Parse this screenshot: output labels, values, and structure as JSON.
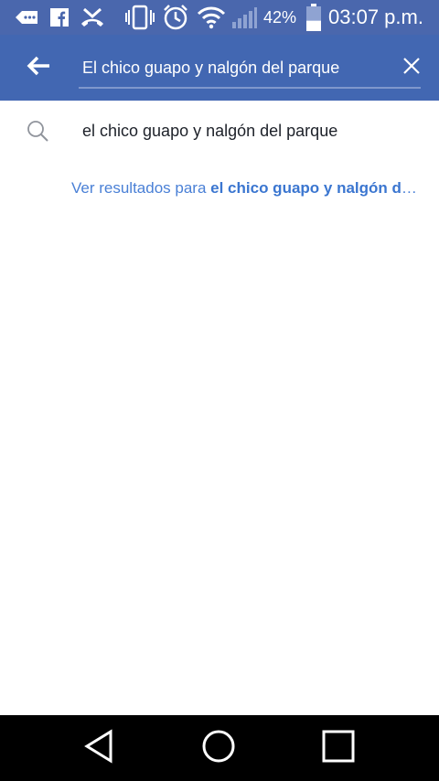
{
  "status_bar": {
    "icons": [
      "messenger-icon",
      "facebook-icon",
      "missed-call-icon",
      "vibrate-icon",
      "alarm-icon",
      "wifi-icon",
      "signal-icon"
    ],
    "battery_percent_label": "42%",
    "battery_level": 0.42,
    "time": "03:07 p.m."
  },
  "app_bar": {
    "back_icon": "arrow-left-icon",
    "search_value": "El chico guapo y nalgón del parque",
    "clear_icon": "close-icon"
  },
  "suggestion": {
    "icon": "search-icon",
    "text": "el chico guapo y nalgón del parque"
  },
  "see_results": {
    "prefix": "Ver resultados para ",
    "query": "el chico guapo y nalgón del parque"
  },
  "nav_bar": {
    "icons": [
      "back-triangle-icon",
      "home-circle-icon",
      "recents-square-icon"
    ]
  },
  "colors": {
    "status_bar": "#4a67ad",
    "app_bar": "#4267b2",
    "link": "#4a80d6",
    "nav_bar": "#000000"
  }
}
